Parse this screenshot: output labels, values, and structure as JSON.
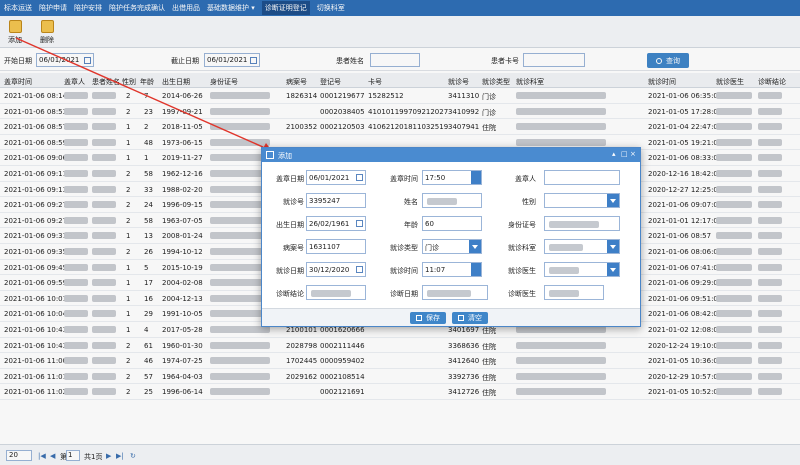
{
  "nav": [
    "标本运送",
    "陪护申请",
    "陪护安排",
    "陪护任务完成确认",
    "出借用品",
    "基础数据维护 ▾",
    "诊断证明登记",
    "切换科室"
  ],
  "nav_active_index": 6,
  "toolbar": {
    "add_label": "添加",
    "delete_label": "删除"
  },
  "filter": {
    "start_label": "开始日期",
    "start_value": "06/01/2021",
    "end_label": "截止日期",
    "end_value": "06/01/2021",
    "patient_name_label": "患者姓名",
    "patient_card_label": "患者卡号",
    "search_label": "查询"
  },
  "columns": [
    "盖章时间",
    "盖章人",
    "患者姓名",
    "性别",
    "年龄",
    "出生日期",
    "身份证号",
    "病案号",
    "登记号",
    "卡号",
    "就诊号",
    "就诊类型",
    "就诊科室",
    "就诊时间",
    "就诊医生",
    "诊断结论"
  ],
  "rows": [
    {
      "stamp_time": "2021-01-06 08:14:00",
      "gender": "2",
      "age": "7",
      "birth": "2014-06-26",
      "mrn": "1826314",
      "reg": "0001219677",
      "card": "15282512",
      "visit": "3411310",
      "type": "门诊",
      "visit_time": "2021-01-06 06:35:00"
    },
    {
      "stamp_time": "2021-01-06 08:53:00",
      "gender": "2",
      "age": "23",
      "birth": "1997-09-21",
      "mrn": "",
      "reg": "0002038405",
      "card": "410101199709212027",
      "visit": "3410992",
      "type": "门诊",
      "visit_time": "2021-01-05 17:28:00"
    },
    {
      "stamp_time": "2021-01-06 08:57:00",
      "gender": "1",
      "age": "2",
      "birth": "2018-11-05",
      "mrn": "2100352",
      "reg": "0002120503",
      "card": "410621201811032519",
      "visit": "3407941",
      "type": "住院",
      "visit_time": "2021-01-04 22:47:00"
    },
    {
      "stamp_time": "2021-01-06 08:59:00",
      "gender": "1",
      "age": "48",
      "birth": "1973-06-15",
      "mrn": "",
      "reg": "",
      "card": "",
      "visit": "",
      "type": "",
      "visit_time": "2021-01-05 19:21:00"
    },
    {
      "stamp_time": "2021-01-06 09:06:00",
      "gender": "1",
      "age": "1",
      "birth": "2019-11-27",
      "mrn": "",
      "reg": "",
      "card": "",
      "visit": "",
      "type": "",
      "visit_time": "2021-01-06 08:33:00"
    },
    {
      "stamp_time": "2021-01-06 09:11:00",
      "gender": "2",
      "age": "58",
      "birth": "1962-12-16",
      "mrn": "",
      "reg": "",
      "card": "",
      "visit": "",
      "type": "",
      "visit_time": "2020-12-16 18:42:00"
    },
    {
      "stamp_time": "2021-01-06 09:13:00",
      "gender": "2",
      "age": "33",
      "birth": "1988-02-20",
      "mrn": "",
      "reg": "",
      "card": "",
      "visit": "",
      "type": "",
      "visit_time": "2020-12-27 12:25:00"
    },
    {
      "stamp_time": "2021-01-06 09:27:00",
      "gender": "2",
      "age": "24",
      "birth": "1996-09-15",
      "mrn": "",
      "reg": "",
      "card": "",
      "visit": "",
      "type": "",
      "visit_time": "2021-01-06 09:07:00"
    },
    {
      "stamp_time": "2021-01-06 09:27:00",
      "gender": "2",
      "age": "58",
      "birth": "1963-07-05",
      "mrn": "",
      "reg": "",
      "card": "",
      "visit": "",
      "type": "",
      "visit_time": "2021-01-01 12:17:00"
    },
    {
      "stamp_time": "2021-01-06 09:31:00",
      "gender": "1",
      "age": "13",
      "birth": "2008-01-24",
      "mrn": "",
      "reg": "",
      "card": "",
      "visit": "",
      "type": "",
      "visit_time": "2021-01-06 08:57"
    },
    {
      "stamp_time": "2021-01-06 09:35:00",
      "gender": "2",
      "age": "26",
      "birth": "1994-10-12",
      "mrn": "",
      "reg": "",
      "card": "",
      "visit": "",
      "type": "",
      "visit_time": "2021-01-06 08:06:00"
    },
    {
      "stamp_time": "2021-01-06 09:45:00",
      "gender": "1",
      "age": "5",
      "birth": "2015-10-19",
      "mrn": "",
      "reg": "",
      "card": "",
      "visit": "",
      "type": "",
      "visit_time": "2021-01-06 07:41:00"
    },
    {
      "stamp_time": "2021-01-06 09:59:00",
      "gender": "1",
      "age": "17",
      "birth": "2004-02-08",
      "mrn": "",
      "reg": "",
      "card": "",
      "visit": "",
      "type": "",
      "visit_time": "2021-01-06 09:29:00"
    },
    {
      "stamp_time": "2021-01-06 10:01:00",
      "gender": "1",
      "age": "16",
      "birth": "2004-12-13",
      "mrn": "",
      "reg": "",
      "card": "",
      "visit": "",
      "type": "",
      "visit_time": "2021-01-06 09:51:00"
    },
    {
      "stamp_time": "2021-01-06 10:04:00",
      "gender": "1",
      "age": "29",
      "birth": "1991-10-05",
      "mrn": "",
      "reg": "",
      "card": "",
      "visit": "",
      "type": "",
      "visit_time": "2021-01-06 08:42:00"
    },
    {
      "stamp_time": "2021-01-06 10:43:00",
      "gender": "1",
      "age": "4",
      "birth": "2017-05-28",
      "mrn": "2100101",
      "reg": "0001620666",
      "card": "",
      "visit": "3401697",
      "type": "住院",
      "visit_time": "2021-01-02 12:08:00"
    },
    {
      "stamp_time": "2021-01-06 10:43:00",
      "gender": "2",
      "age": "61",
      "birth": "1960-01-30",
      "mrn": "2028798",
      "reg": "0002111446",
      "card": "",
      "visit": "3368636",
      "type": "住院",
      "visit_time": "2020-12-24 19:10:00"
    },
    {
      "stamp_time": "2021-01-06 11:00:00",
      "gender": "2",
      "age": "46",
      "birth": "1974-07-25",
      "mrn": "1702445",
      "reg": "0000959402",
      "card": "",
      "visit": "3412640",
      "type": "住院",
      "visit_time": "2021-01-05 10:36:00"
    },
    {
      "stamp_time": "2021-01-06 11:01:00",
      "gender": "2",
      "age": "57",
      "birth": "1964-04-03",
      "mrn": "2029162",
      "reg": "0002108514",
      "card": "",
      "visit": "3392736",
      "type": "住院",
      "visit_time": "2020-12-29 10:57:00"
    },
    {
      "stamp_time": "2021-01-06 11:02:00",
      "gender": "2",
      "age": "25",
      "birth": "1996-06-14",
      "mrn": "",
      "reg": "0002121691",
      "card": "",
      "visit": "3412726",
      "type": "住院",
      "visit_time": "2021-01-05 10:52:00"
    }
  ],
  "pager": {
    "page_size": "20",
    "first": "|◀",
    "prev": "◀",
    "page_label": "第",
    "page_value": "1",
    "total": "共1页",
    "next": "▶",
    "last": "▶|",
    "refresh": "↻"
  },
  "modal": {
    "title": "添加",
    "ctl_min": "▴",
    "ctl_max": "□",
    "ctl_close": "×",
    "stamp_date_label": "盖章日期",
    "stamp_date_value": "06/01/2021",
    "stamp_time_label": "盖章时间",
    "stamp_time_value": "17:50",
    "stamp_person_label": "盖章人",
    "visit_no_label": "就诊号",
    "visit_no_value": "3395247",
    "name_label": "姓名",
    "gender_label": "性别",
    "birth_label": "出生日期",
    "birth_value": "26/02/1961",
    "age_label": "年龄",
    "age_value": "60",
    "id_label": "身份证号",
    "mrn_label": "病案号",
    "mrn_value": "1631107",
    "visit_type_label": "就诊类型",
    "visit_type_value": "门诊",
    "dept_label": "就诊科室",
    "visit_date_label": "就诊日期",
    "visit_date_value": "30/12/2020",
    "visit_time_label": "就诊时间",
    "visit_time_value": "11:07",
    "dept2_label": "就诊医生",
    "diagnosis_label": "诊断结论",
    "diag_date_label": "诊断日期",
    "doctor_label": "诊断医生",
    "save_label": "保存",
    "clear_label": "清空"
  },
  "colors": {
    "nav_bg": "#2f6fb6",
    "modal_header": "#4a8bd0",
    "button": "#3f86c9",
    "arrow": "#e0352b"
  }
}
